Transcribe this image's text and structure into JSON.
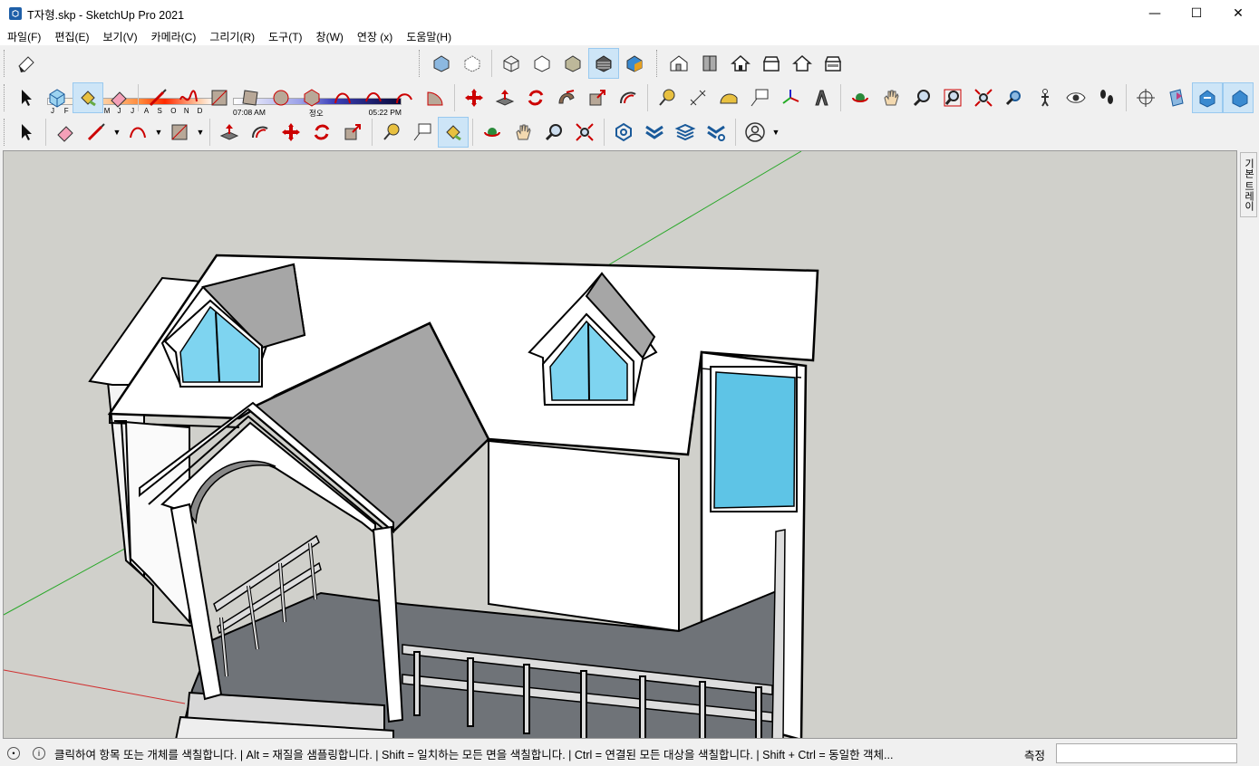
{
  "window": {
    "title": "T자형.skp - SketchUp Pro 2021",
    "minimize": "—",
    "maximize": "☐",
    "close": "✕"
  },
  "menu": [
    "파일(F)",
    "편집(E)",
    "보기(V)",
    "카메라(C)",
    "그리기(R)",
    "도구(T)",
    "창(W)",
    "연장 (x)",
    "도움말(H)"
  ],
  "shadows": {
    "months": [
      "J",
      "F",
      "M",
      "A",
      "M",
      "J",
      "J",
      "A",
      "S",
      "O",
      "N",
      "D"
    ],
    "time_start": "07:08 AM",
    "time_mid": "정오",
    "time_end": "05:22 PM"
  },
  "tray": {
    "tab_label": "기본 트레이"
  },
  "status": {
    "hint": "클릭하여 항목 또는 개체를 색칠합니다. | Alt = 재질을 샘플링합니다. | Shift = 일치하는 모든 면을 색칠합니다. | Ctrl = 연결된 모든 대상을 색칠합니다. | Shift + Ctrl = 동일한 객체...",
    "measure_label": "측정",
    "measure_value": ""
  },
  "colors": {
    "viewport_bg": "#d0d0cb",
    "glass": "#7ed4f0",
    "floor": "#6f7378",
    "roof": "#a6a6a6",
    "axis_green": "#2aa82a",
    "axis_red": "#d03030"
  }
}
